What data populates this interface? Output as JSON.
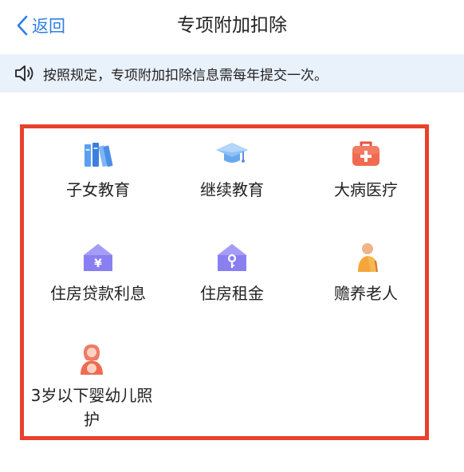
{
  "header": {
    "back_label": "返回",
    "title": "专项附加扣除"
  },
  "notice": {
    "icon": "speaker-icon",
    "text": "按照规定，专项附加扣除信息需每年提交一次。"
  },
  "items": [
    {
      "label": "子女教育",
      "icon": "books-icon"
    },
    {
      "label": "继续教育",
      "icon": "graduation-cap-icon"
    },
    {
      "label": "大病医疗",
      "icon": "medical-kit-icon"
    },
    {
      "label": "住房贷款利息",
      "icon": "house-yuan-icon"
    },
    {
      "label": "住房租金",
      "icon": "house-key-icon"
    },
    {
      "label": "赡养老人",
      "icon": "elderly-person-icon"
    },
    {
      "label": "3岁以下婴幼儿照护",
      "icon": "mother-baby-icon"
    }
  ],
  "colors": {
    "accent": "#2f7fe6",
    "highlight_border": "#e8412c",
    "notice_bg": "#e9f1fb"
  }
}
